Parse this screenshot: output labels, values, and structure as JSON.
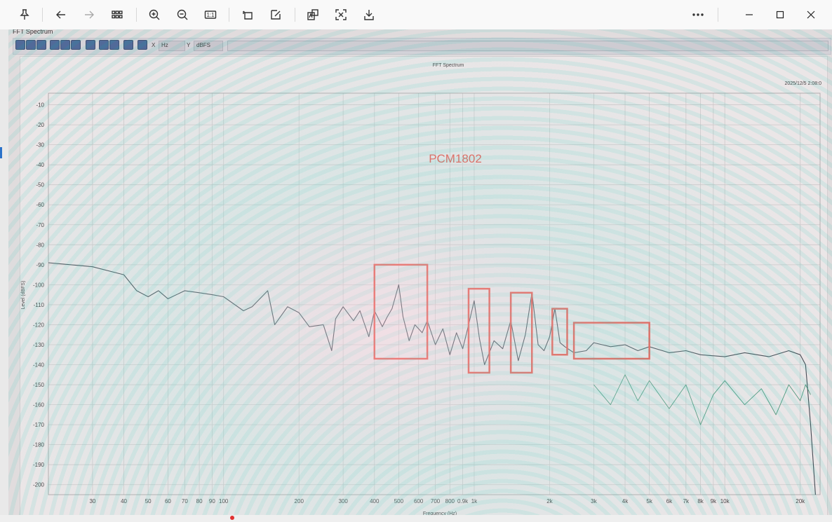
{
  "viewer": {
    "toolbar": {
      "buttons": [
        {
          "name": "pin-icon",
          "label": "Pin"
        },
        {
          "name": "back-arrow-icon",
          "label": "Back"
        },
        {
          "name": "forward-arrow-icon",
          "label": "Forward"
        },
        {
          "name": "grid-view-icon",
          "label": "Gallery"
        },
        {
          "name": "zoom-in-icon",
          "label": "Zoom in"
        },
        {
          "name": "zoom-out-icon",
          "label": "Zoom out"
        },
        {
          "name": "actual-size-icon",
          "label": "1:1"
        },
        {
          "name": "rotate-icon",
          "label": "Rotate"
        },
        {
          "name": "edit-icon",
          "label": "Edit"
        },
        {
          "name": "translate-icon",
          "label": "Translate"
        },
        {
          "name": "extract-text-icon",
          "label": "Extract text"
        },
        {
          "name": "save-icon",
          "label": "Save"
        },
        {
          "name": "more-icon",
          "label": "More"
        }
      ],
      "actual_size_text": "1:1"
    }
  },
  "app": {
    "window_title": "FFT Spectrum",
    "x_label": "X",
    "x_unit": "Hz",
    "y_label": "Y",
    "y_unit": "dBFS"
  },
  "chart_data": {
    "type": "line",
    "title": "FFT Spectrum",
    "timestamp": "2025/12/5 2:08:0",
    "annotation": "PCM1802",
    "xlabel": "Frequency (Hz)",
    "ylabel": "Level (dBFS)",
    "xscale": "log",
    "xlim": [
      20,
      24000
    ],
    "ylim": [
      -205,
      -7
    ],
    "grid": true,
    "y_ticks": [
      "-10",
      "-20",
      "-30",
      "-40",
      "-50",
      "-60",
      "-70",
      "-80",
      "-90",
      "-100",
      "-110",
      "-120",
      "-130",
      "-140",
      "-150",
      "-160",
      "-170",
      "-180",
      "-190",
      "-200"
    ],
    "y_tick_values": [
      -10,
      -20,
      -30,
      -40,
      -50,
      -60,
      -70,
      -80,
      -90,
      -100,
      -110,
      -120,
      -130,
      -140,
      -150,
      -160,
      -170,
      -180,
      -190,
      -200
    ],
    "x_ticks": [
      "30",
      "40",
      "50",
      "60",
      "70",
      "80",
      "90",
      "100",
      "200",
      "300",
      "400",
      "500",
      "600",
      "700",
      "800",
      "0.9k",
      "1k",
      "2k",
      "3k",
      "4k",
      "5k",
      "6k",
      "7k",
      "8k",
      "9k",
      "10k",
      "20k"
    ],
    "x_tick_values": [
      30,
      40,
      50,
      60,
      70,
      80,
      90,
      100,
      200,
      300,
      400,
      500,
      600,
      700,
      800,
      900,
      1000,
      2000,
      3000,
      4000,
      5000,
      6000,
      7000,
      8000,
      9000,
      10000,
      20000
    ],
    "series": [
      {
        "x": [
          20,
          30,
          40,
          45,
          50,
          55,
          60,
          70,
          80,
          90,
          100,
          120,
          130,
          150,
          160,
          180,
          200,
          220,
          250,
          270,
          280,
          300,
          330,
          350,
          380,
          400,
          430,
          450,
          470,
          500,
          520,
          550,
          580,
          620,
          650,
          700,
          750,
          800,
          850,
          900,
          950,
          1000,
          1050,
          1100,
          1200,
          1300,
          1400,
          1500,
          1600,
          1700,
          1800,
          1900,
          2000,
          2100,
          2200,
          2300,
          2500,
          2800,
          3000,
          3500,
          4000,
          4500,
          5000,
          6000,
          7000,
          8000,
          10000,
          12000,
          15000,
          18000,
          20000,
          21000,
          22000,
          23000
        ],
        "values": [
          -89,
          -91,
          -95,
          -103,
          -106,
          -103,
          -107,
          -103,
          -104,
          -105,
          -106,
          -113,
          -111,
          -103,
          -120,
          -111,
          -114,
          -121,
          -120,
          -133,
          -117,
          -111,
          -118,
          -113,
          -126,
          -113,
          -121,
          -116,
          -112,
          -100,
          -116,
          -128,
          -120,
          -124,
          -118,
          -130,
          -122,
          -135,
          -124,
          -132,
          -120,
          -108,
          -127,
          -140,
          -128,
          -132,
          -118,
          -138,
          -125,
          -104,
          -130,
          -133,
          -126,
          -112,
          -129,
          -131,
          -134,
          -133,
          -129,
          -131,
          -130,
          -133,
          -131,
          -134,
          -133,
          -135,
          -136,
          -134,
          -136,
          -133,
          -135,
          -140,
          -170,
          -205
        ],
        "color": "#2f3d45"
      },
      {
        "x": [
          3000,
          3500,
          4000,
          4500,
          5000,
          6000,
          7000,
          8000,
          9000,
          10000,
          12000,
          14000,
          16000,
          18000,
          20000,
          21000,
          22000
        ],
        "values": [
          -150,
          -160,
          -145,
          -158,
          -148,
          -162,
          -150,
          -170,
          -155,
          -148,
          -160,
          -152,
          -165,
          -150,
          -158,
          -150,
          -155
        ],
        "color": "#0f7a52"
      }
    ],
    "highlight_boxes": [
      {
        "x_range": [
          400,
          650
        ],
        "y_range": [
          -90,
          -137
        ]
      },
      {
        "x_range": [
          950,
          1150
        ],
        "y_range": [
          -102,
          -144
        ]
      },
      {
        "x_range": [
          1400,
          1700
        ],
        "y_range": [
          -104,
          -144
        ]
      },
      {
        "x_range": [
          2050,
          2350
        ],
        "y_range": [
          -112,
          -135
        ]
      },
      {
        "x_range": [
          2500,
          5000
        ],
        "y_range": [
          -119,
          -137
        ]
      }
    ]
  }
}
